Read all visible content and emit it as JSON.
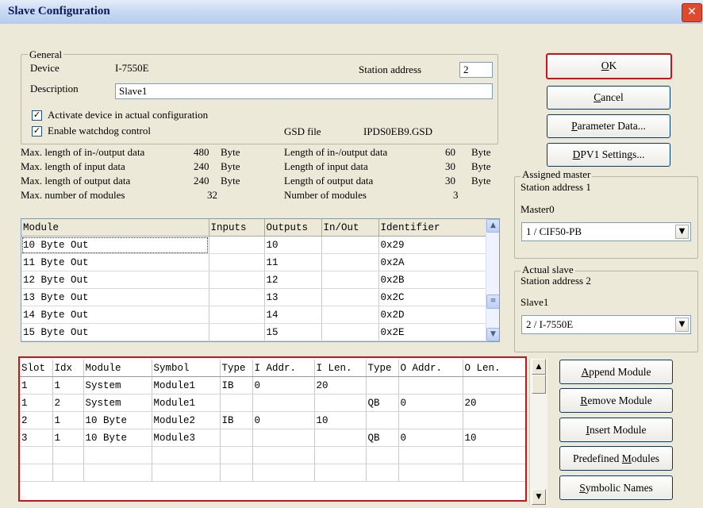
{
  "window": {
    "title": "Slave Configuration",
    "close_glyph": "✕"
  },
  "general": {
    "legend": "General",
    "device_label": "Device",
    "device_value": "I-7550E",
    "station_address_label": "Station address",
    "station_address_value": "2",
    "description_label": "Description",
    "description_value": "Slave1",
    "activate_label": "Activate device in actual configuration",
    "activate_checked": true,
    "watchdog_label": "Enable watchdog control",
    "watchdog_checked": true,
    "gsd_label": "GSD file",
    "gsd_value": "IPDS0EB9.GSD"
  },
  "stats": {
    "left": [
      {
        "label": "Max. length of in-/output data",
        "value": "480",
        "unit": "Byte"
      },
      {
        "label": "Max. length of input data",
        "value": "240",
        "unit": "Byte"
      },
      {
        "label": "Max. length of output data",
        "value": "240",
        "unit": "Byte"
      },
      {
        "label": "Max. number of modules",
        "value": "32",
        "unit": ""
      }
    ],
    "right": [
      {
        "label": "Length of in-/output data",
        "value": "60",
        "unit": "Byte"
      },
      {
        "label": "Length of input data",
        "value": "30",
        "unit": "Byte"
      },
      {
        "label": "Length of output data",
        "value": "30",
        "unit": "Byte"
      },
      {
        "label": "Number of modules",
        "value": "3",
        "unit": ""
      }
    ]
  },
  "module_table": {
    "headers": [
      "Module",
      "Inputs",
      "Outputs",
      "In/Out",
      "Identifier"
    ],
    "rows": [
      [
        "10 Byte Out",
        "",
        "10",
        "",
        "0x29"
      ],
      [
        "11 Byte Out",
        "",
        "11",
        "",
        "0x2A"
      ],
      [
        "12 Byte Out",
        "",
        "12",
        "",
        "0x2B"
      ],
      [
        "13 Byte Out",
        "",
        "13",
        "",
        "0x2C"
      ],
      [
        "14 Byte Out",
        "",
        "14",
        "",
        "0x2D"
      ],
      [
        "15 Byte Out",
        "",
        "15",
        "",
        "0x2E"
      ]
    ]
  },
  "slot_table": {
    "headers": [
      "Slot",
      "Idx",
      "Module",
      "Symbol",
      "Type",
      "I Addr.",
      "I Len.",
      "Type",
      "O Addr.",
      "O Len."
    ],
    "rows": [
      [
        "1",
        "1",
        "System",
        "Module1",
        "IB",
        "0",
        "20",
        "",
        "",
        ""
      ],
      [
        "1",
        "2",
        "System",
        "Module1",
        "",
        "",
        "",
        "QB",
        "0",
        "20"
      ],
      [
        "2",
        "1",
        "10 Byte",
        "Module2",
        "IB",
        "0",
        "10",
        "",
        "",
        ""
      ],
      [
        "3",
        "1",
        "10 Byte",
        "Module3",
        "",
        "",
        "",
        "QB",
        "0",
        "10"
      ],
      [
        "",
        "",
        "",
        "",
        "",
        "",
        "",
        "",
        "",
        ""
      ],
      [
        "",
        "",
        "",
        "",
        "",
        "",
        "",
        "",
        "",
        ""
      ]
    ]
  },
  "buttons": {
    "ok": {
      "pre": "",
      "u": "O",
      "post": "K"
    },
    "cancel": {
      "pre": "",
      "u": "C",
      "post": "ancel"
    },
    "parameter": {
      "pre": "",
      "u": "P",
      "post": "arameter Data..."
    },
    "dpv1": {
      "pre": "",
      "u": "D",
      "post": "PV1 Settings..."
    },
    "append": {
      "pre": "",
      "u": "A",
      "post": "ppend Module"
    },
    "remove": {
      "pre": "",
      "u": "R",
      "post": "emove Module"
    },
    "insert": {
      "pre": "",
      "u": "I",
      "post": "nsert Module"
    },
    "predefined": {
      "pre": "Predefined ",
      "u": "M",
      "post": "odules"
    },
    "symbolic": {
      "pre": "",
      "u": "S",
      "post": "ymbolic Names"
    }
  },
  "assigned_master": {
    "legend": "Assigned master",
    "station_line": "Station address 1",
    "name": "Master0",
    "combo_value": "1 / CIF50-PB"
  },
  "actual_slave": {
    "legend": "Actual slave",
    "station_line": "Station address 2",
    "name": "Slave1",
    "combo_value": "2 / I-7550E"
  },
  "colors": {
    "highlight_border": "#c8141e",
    "title_text": "#0b1a5c",
    "close_button": "#e04a2c"
  }
}
